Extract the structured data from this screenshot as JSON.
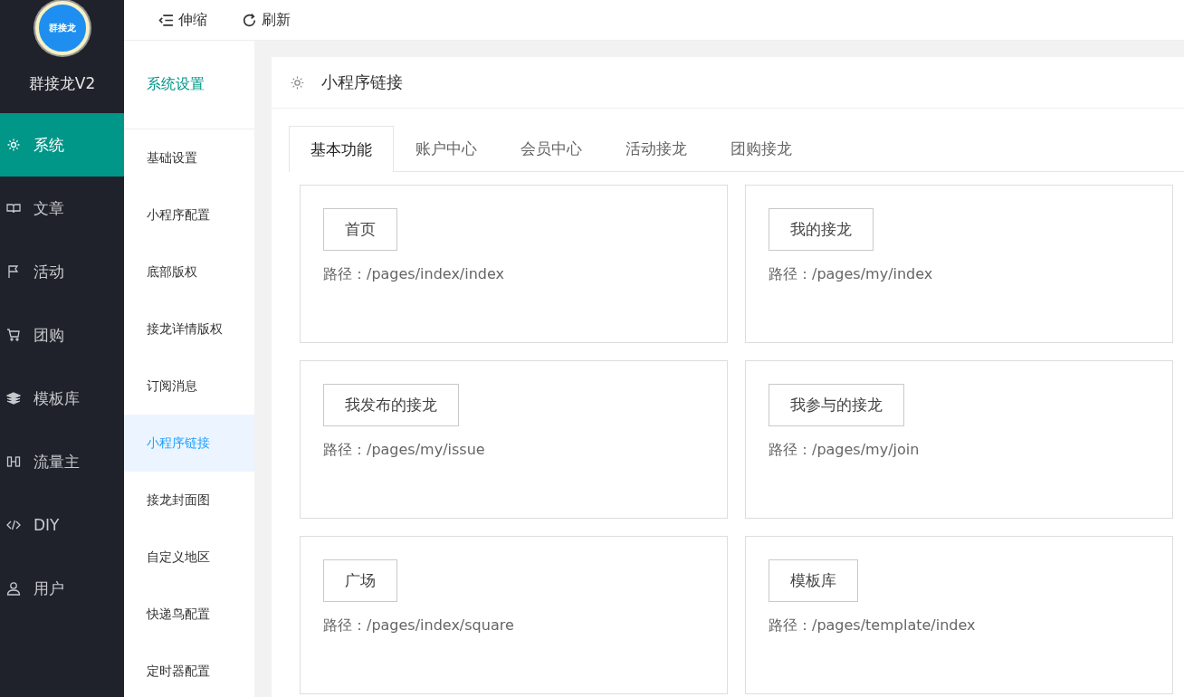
{
  "logo": {
    "badge": "群接龙",
    "title": "群接龙V2"
  },
  "nav": [
    {
      "label": "系统",
      "selected": true
    },
    {
      "label": "文章",
      "selected": false
    },
    {
      "label": "活动",
      "selected": false
    },
    {
      "label": "团购",
      "selected": false
    },
    {
      "label": "模板库",
      "selected": false
    },
    {
      "label": "流量主",
      "selected": false
    },
    {
      "label": "DIY",
      "selected": false
    },
    {
      "label": "用户",
      "selected": false
    }
  ],
  "toolbar": [
    {
      "label": "伸缩"
    },
    {
      "label": "刷新"
    }
  ],
  "subnav": {
    "title": "系统设置",
    "items": [
      {
        "label": "基础设置",
        "selected": false
      },
      {
        "label": "小程序配置",
        "selected": false
      },
      {
        "label": "底部版权",
        "selected": false
      },
      {
        "label": "接龙详情版权",
        "selected": false
      },
      {
        "label": "订阅消息",
        "selected": false
      },
      {
        "label": "小程序链接",
        "selected": true
      },
      {
        "label": "接龙封面图",
        "selected": false
      },
      {
        "label": "自定义地区",
        "selected": false
      },
      {
        "label": "快递鸟配置",
        "selected": false
      },
      {
        "label": "定时器配置",
        "selected": false
      }
    ]
  },
  "panel": {
    "title": "小程序链接",
    "tabs": [
      {
        "label": "基本功能",
        "selected": true
      },
      {
        "label": "账户中心",
        "selected": false
      },
      {
        "label": "会员中心",
        "selected": false
      },
      {
        "label": "活动接龙",
        "selected": false
      },
      {
        "label": "团购接龙",
        "selected": false
      }
    ],
    "links": [
      {
        "name": "首页",
        "path": "路径：/pages/index/index"
      },
      {
        "name": "我的接龙",
        "path": "路径：/pages/my/index"
      },
      {
        "name": "我发布的接龙",
        "path": "路径：/pages/my/issue"
      },
      {
        "name": "我参与的接龙",
        "path": "路径：/pages/my/join"
      },
      {
        "name": "广场",
        "path": "路径：/pages/index/square"
      },
      {
        "name": "模板库",
        "path": "路径：/pages/template/index"
      }
    ]
  }
}
